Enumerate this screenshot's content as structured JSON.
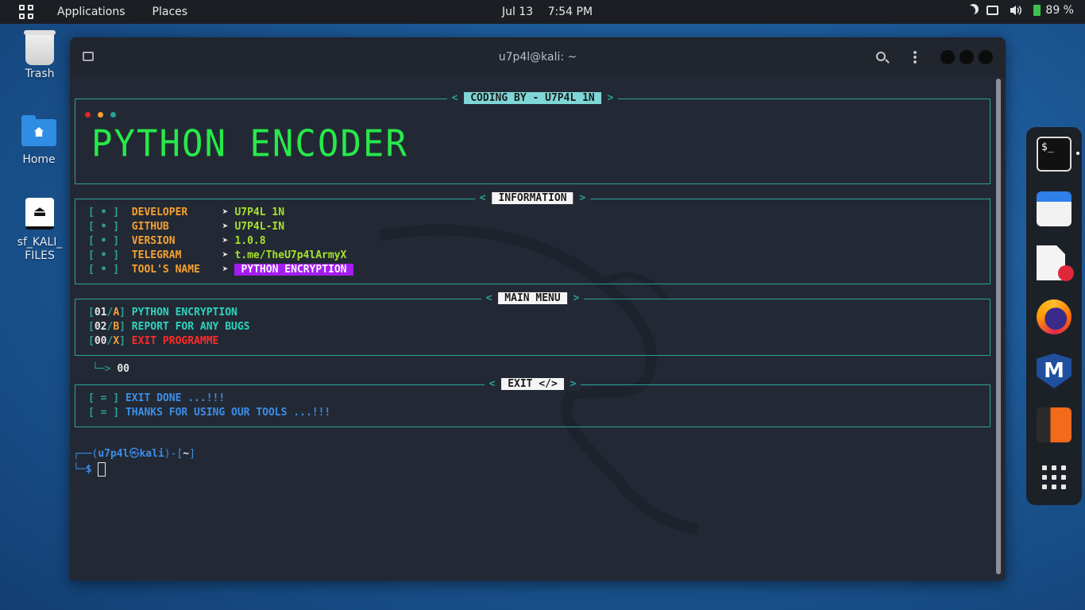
{
  "top_panel": {
    "applications": "Applications",
    "places": "Places",
    "date": "Jul 13",
    "time": "7:54 PM",
    "battery": "89 %",
    "icons": [
      "apps-grid-icon",
      "moon-icon",
      "screen-icon",
      "speaker-icon",
      "battery-icon"
    ]
  },
  "desktop": {
    "trash_label": "Trash",
    "home_label": "Home",
    "drive_label_line1": "sf_KALI_",
    "drive_label_line2": "FILES"
  },
  "terminal": {
    "title": "u7p4l@kali: ~",
    "header_box": {
      "title": "CODING BY - U7P4L 1N",
      "banner": "PYTHON ENCODER"
    },
    "info_box": {
      "title": "INFORMATION",
      "bullet": "[ • ]",
      "arrow": "➤",
      "rows": [
        {
          "key": "DEVELOPER",
          "value": "U7P4L 1N"
        },
        {
          "key": "GITHUB",
          "value": "U7P4L-IN"
        },
        {
          "key": "VERSION",
          "value": "1.0.8"
        },
        {
          "key": "TELEGRAM",
          "value": "t.me/TheU7p4lArmyX"
        },
        {
          "key": "TOOL'S NAME",
          "value": "PYTHON ENCRYPTION"
        }
      ]
    },
    "menu_box": {
      "title": "MAIN MENU",
      "items": [
        {
          "num": "01",
          "key": "A",
          "label": "PYTHON ENCRYPTION"
        },
        {
          "num": "02",
          "key": "B",
          "label": "REPORT FOR ANY BUGS"
        },
        {
          "num": "00",
          "key": "X",
          "label": "EXIT PROGRAMME"
        }
      ]
    },
    "input_arrow": "└─>",
    "input_value": "00",
    "exit_box": {
      "title": "EXIT </>",
      "lines": [
        "EXIT DONE ...!!!",
        "THANKS FOR USING OUR TOOLS ...!!!"
      ],
      "bullet": "[ = ]"
    },
    "prompt": {
      "line1_prefix": "┌──(",
      "user": "u7p4l",
      "at": "㉿",
      "host": "kali",
      "mid": ")-[",
      "dir": "~",
      "end": "]",
      "line2_prefix": "└─",
      "dollar": "$"
    }
  },
  "dock": {
    "items": [
      "terminal-icon",
      "files-icon",
      "text-editor-icon",
      "firefox-icon",
      "metasploit-icon",
      "burpsuite-icon",
      "app-grid-icon"
    ],
    "terminal_glyph": "$_"
  }
}
